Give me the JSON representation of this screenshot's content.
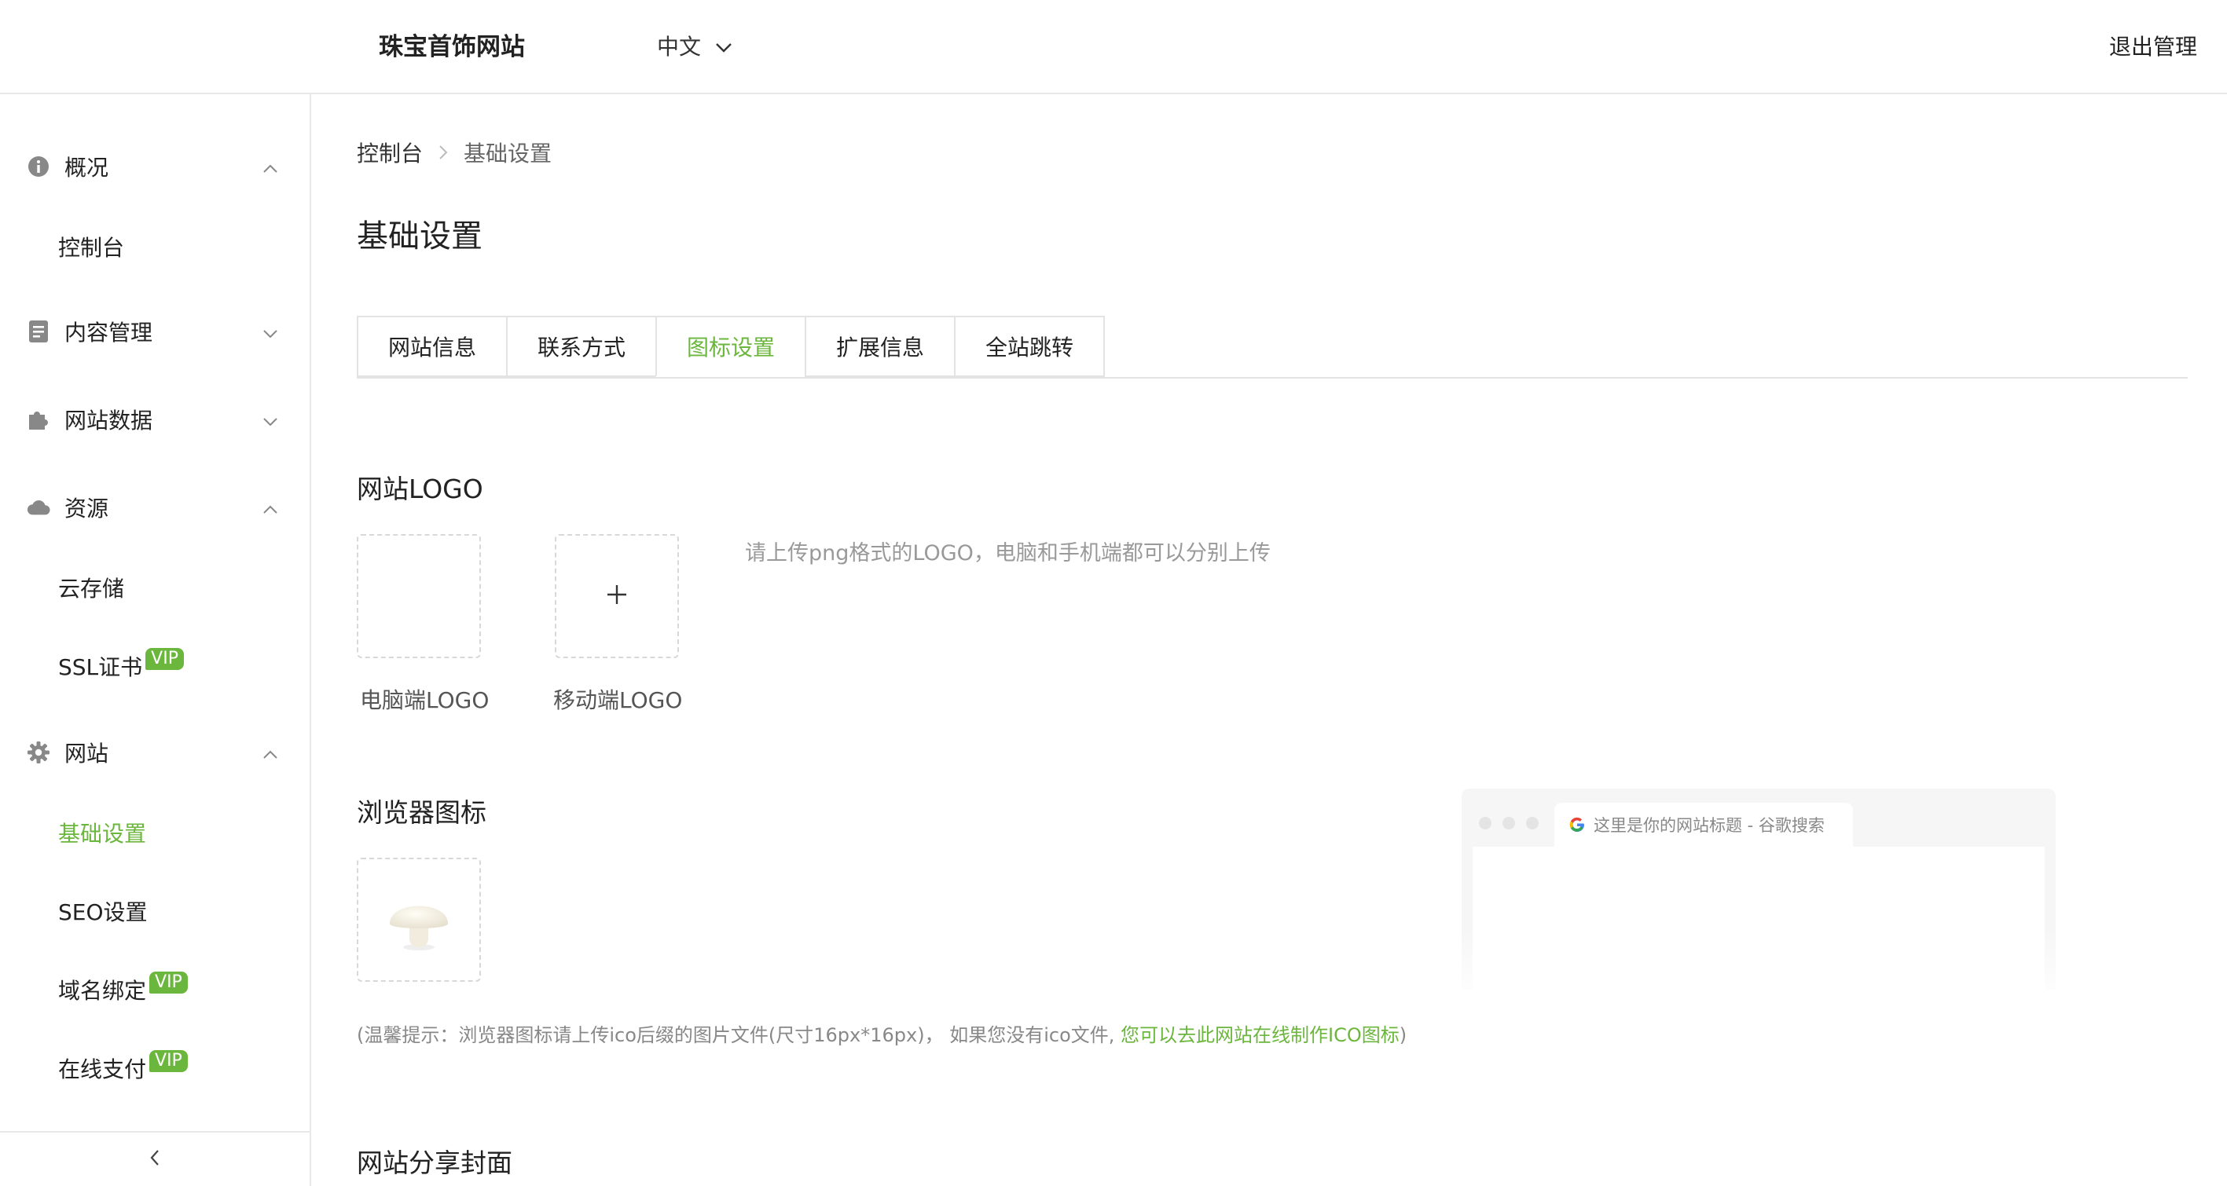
{
  "header": {
    "site_title": "珠宝首饰网站",
    "language": "中文",
    "logout": "退出管理"
  },
  "sidebar": {
    "groups": [
      {
        "label": "概况",
        "icon": "info-circle-icon",
        "expanded": true,
        "items": [
          {
            "label": "控制台"
          }
        ]
      },
      {
        "label": "内容管理",
        "icon": "document-icon",
        "expanded": false,
        "items": []
      },
      {
        "label": "网站数据",
        "icon": "puzzle-icon",
        "expanded": false,
        "items": []
      },
      {
        "label": "资源",
        "icon": "cloud-icon",
        "expanded": true,
        "items": [
          {
            "label": "云存储"
          },
          {
            "label": "SSL证书",
            "vip": "VIP"
          }
        ]
      },
      {
        "label": "网站",
        "icon": "gear-icon",
        "expanded": true,
        "items": [
          {
            "label": "基础设置",
            "active": true
          },
          {
            "label": "SEO设置"
          },
          {
            "label": "域名绑定",
            "vip": "VIP"
          },
          {
            "label": "在线支付",
            "vip": "VIP"
          }
        ]
      }
    ]
  },
  "breadcrumb": {
    "root": "控制台",
    "current": "基础设置"
  },
  "page_title": "基础设置",
  "tabs": [
    {
      "label": "网站信息"
    },
    {
      "label": "联系方式"
    },
    {
      "label": "图标设置",
      "active": true
    },
    {
      "label": "扩展信息"
    },
    {
      "label": "全站跳转"
    }
  ],
  "logo_section": {
    "title": "网站LOGO",
    "pc_label": "电脑端LOGO",
    "mobile_label": "移动端LOGO",
    "hint": "请上传png格式的LOGO，电脑和手机端都可以分别上传"
  },
  "favicon_section": {
    "title": "浏览器图标",
    "preview_tab_title": "这里是你的网站标题 - 谷歌搜索",
    "tip_prefix": "(温馨提示：浏览器图标请上传ico后缀的图片文件(尺寸16px*16px)，  如果您没有ico文件, ",
    "tip_link": "您可以去此网站在线制作ICO图标",
    "tip_suffix": ")"
  },
  "share_section": {
    "title": "网站分享封面"
  },
  "colors": {
    "accent": "#6bb63c",
    "border": "#e3e3e3",
    "muted": "#999999"
  }
}
